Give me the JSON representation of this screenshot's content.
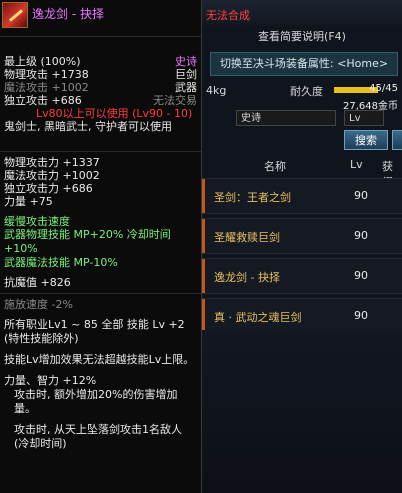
{
  "tooltip": {
    "item_name": "逸龙剑 - 抉择",
    "lines": {
      "top_level": "最上级 (100%)",
      "rarity": "史诗",
      "phys_atk": "物理攻击 +1738",
      "type_big": "巨剑",
      "mag_atk": "魔法攻击 +1002",
      "type_weapon": "武器",
      "indep_atk": "独立攻击 +686",
      "no_trade": "无法交易",
      "level_req": "Lv80以上可以使用 (Lv90 - 10)",
      "classes": "鬼剑士, 黑暗武士, 守护者可以使用",
      "phys_power": "物理攻击力 +1337",
      "mag_power": "魔法攻击力 +1002",
      "indep_power": "独立攻击力 +686",
      "strength": "力量 +75",
      "slow_atk_speed": "缓慢攻击速度",
      "weapon_phys_skill": "武器物理技能   MP+20% 冷却时间+10%",
      "weapon_mag_skill": "武器魔法技能   MP-10%",
      "anti_magic": "抗魔值 +826",
      "cast_speed": "施放速度 -2%",
      "all_jobs": "所有职业Lv1 ~ 85 全部 技能 Lv +2 (特性技能除外)",
      "skill_limit": "技能Lv增加效果无法超越技能Lv上限。",
      "str_int": "力量、智力 +12%",
      "attack_extra": "攻击时, 额外增加20%的伤害增加量。",
      "attack_sky": "攻击时, 从天上坠落剑攻击1名敌人(冷却时间)"
    }
  },
  "shop": {
    "title": "无法合成",
    "view_summary": "查看简要说明(F4)",
    "switch_label": "切换至决斗场装备属性: <Home>",
    "weight": "4kg",
    "durability_label": "耐久度",
    "durability_value": "45/45",
    "durability_fraction": 1.0,
    "gold": "27,648金币",
    "filter_value": "史诗",
    "lv_value": "Lv",
    "search_label": "搜索",
    "columns": {
      "name": "名称",
      "lv": "Lv",
      "acquire": "获得"
    },
    "items": [
      {
        "name": "圣剑：王者之剑",
        "lv": "90"
      },
      {
        "name": "圣耀救赎巨剑",
        "lv": "90"
      },
      {
        "name": "逸龙剑 - 抉择",
        "lv": "90"
      },
      {
        "name": "真 · 武动之魂巨剑",
        "lv": "90"
      }
    ]
  }
}
